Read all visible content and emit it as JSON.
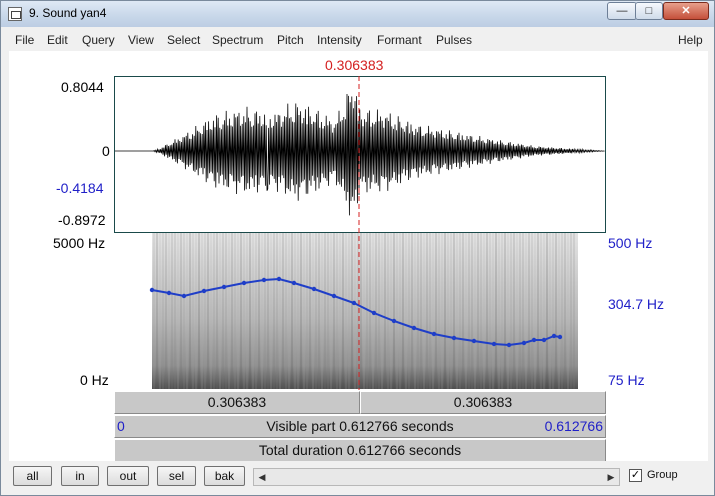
{
  "window": {
    "title": "9. Sound yan4",
    "minimize": "—",
    "maximize": "□",
    "close": "✕"
  },
  "menu": [
    "File",
    "Edit",
    "Query",
    "View",
    "Select",
    "Spectrum",
    "Pitch",
    "Intensity",
    "Formant",
    "Pulses"
  ],
  "help": "Help",
  "cursor": {
    "time": "0.306383"
  },
  "waveform": {
    "top": "0.8044",
    "zero": "0",
    "cursor_value": "-0.4184",
    "bottom": "-0.8972"
  },
  "spectrogram": {
    "top": "5000 Hz",
    "bottom": "0 Hz"
  },
  "pitch": {
    "top": "500 Hz",
    "current": "304.7 Hz",
    "bottom": "75 Hz"
  },
  "selection": {
    "left": "0.306383",
    "right": "0.306383"
  },
  "visible": {
    "start": "0",
    "label": "Visible part 0.612766 seconds",
    "end": "0.612766"
  },
  "total": "Total duration 0.612766 seconds",
  "buttons": {
    "all": "all",
    "in": "in",
    "out": "out",
    "sel": "sel",
    "bak": "bak"
  },
  "group": {
    "label": "Group",
    "checked": "✓"
  },
  "colors": {
    "cursor": "#d42020",
    "pitch": "#1f3ec8",
    "axis_blue": "#2020c8"
  }
}
